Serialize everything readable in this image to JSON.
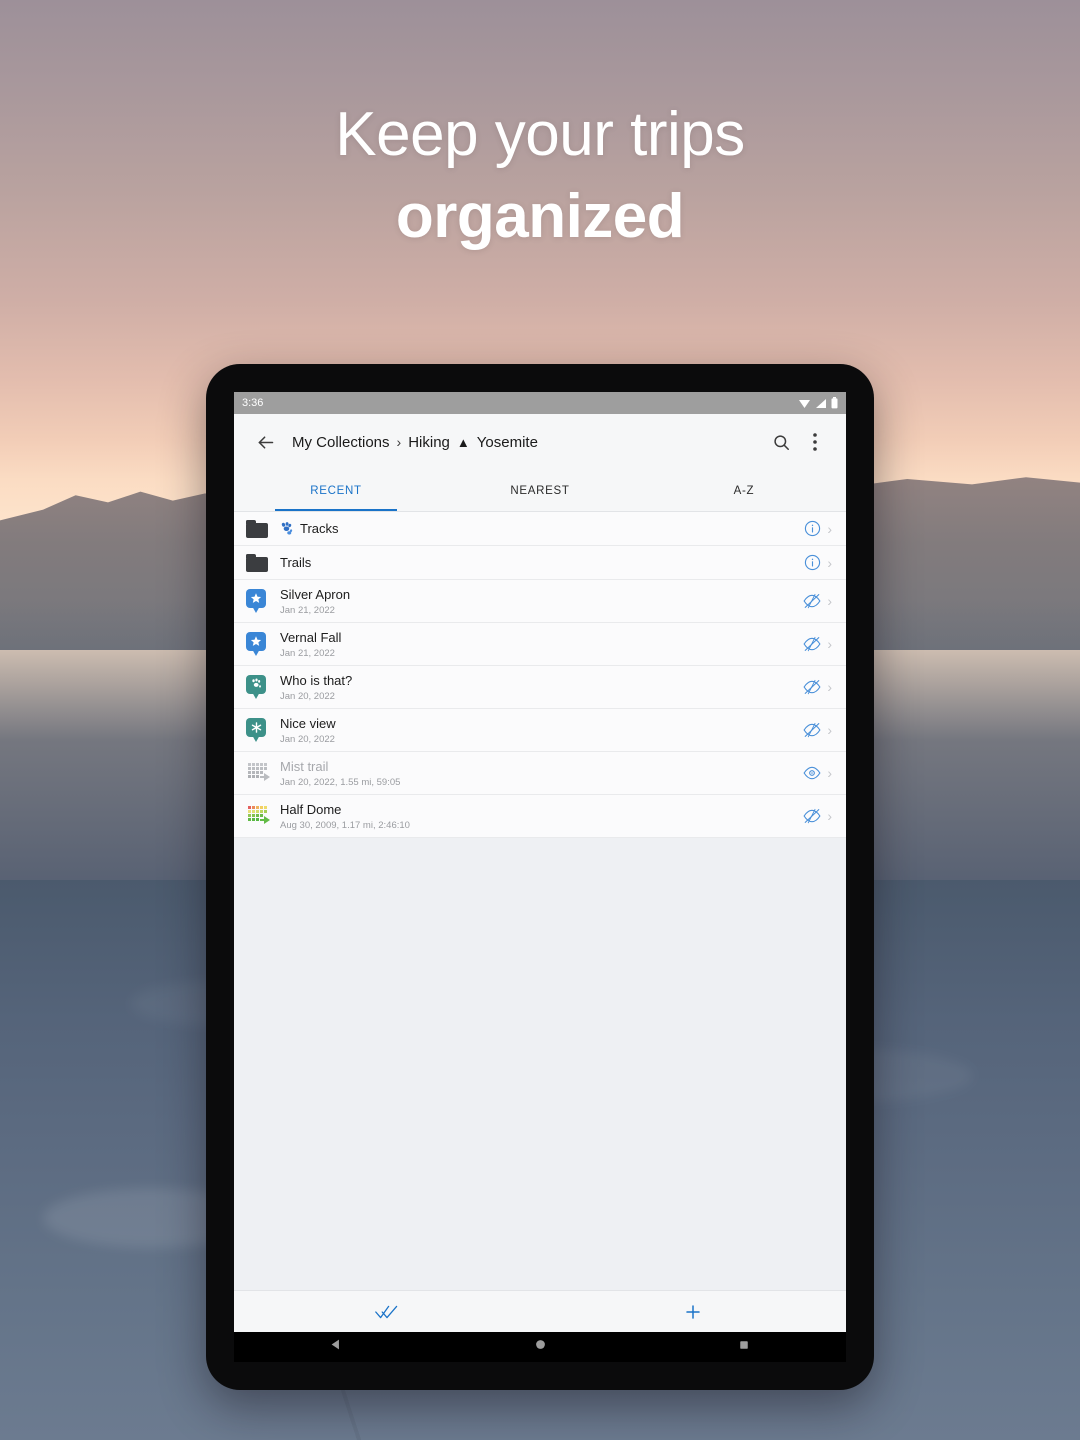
{
  "marketing": {
    "headline_line1": "Keep your trips",
    "headline_line2": "organized"
  },
  "status_bar": {
    "time": "3:36",
    "icons": [
      "wifi-icon",
      "signal-icon",
      "battery-icon"
    ]
  },
  "app_bar": {
    "back_icon": "back-arrow-icon",
    "breadcrumb": {
      "root": "My Collections",
      "separator": "›",
      "parent": "Hiking",
      "marker": "▲",
      "current": "Yosemite"
    },
    "search_icon": "search-icon",
    "overflow_icon": "more-vertical-icon"
  },
  "tabs": [
    {
      "label": "RECENT",
      "active": true
    },
    {
      "label": "NEAREST",
      "active": false
    },
    {
      "label": "A-Z",
      "active": false
    }
  ],
  "list": {
    "folders": [
      {
        "name": "Tracks",
        "badge_icon": "paw-print-icon",
        "has_badge": true,
        "trailing_icon": "info-icon",
        "chevron": "›"
      },
      {
        "name": "Trails",
        "badge_icon": "",
        "has_badge": false,
        "trailing_icon": "info-icon",
        "chevron": "›"
      }
    ],
    "items": [
      {
        "kind": "waypoint",
        "title": "Silver Apron",
        "subtitle": "Jan 21, 2022",
        "icon": "waypoint-star-pin-icon",
        "icon_color": "#3a86d6",
        "glyph": "★",
        "visibility_icon": "eye-hidden-icon",
        "visible": false,
        "chevron": "›",
        "dimmed": false
      },
      {
        "kind": "waypoint",
        "title": "Vernal Fall",
        "subtitle": "Jan 21, 2022",
        "icon": "waypoint-star-pin-icon",
        "icon_color": "#3a86d6",
        "glyph": "★",
        "visibility_icon": "eye-hidden-icon",
        "visible": false,
        "chevron": "›",
        "dimmed": false
      },
      {
        "kind": "waypoint",
        "title": "Who is that?",
        "subtitle": "Jan 20, 2022",
        "icon": "waypoint-paw-pin-icon",
        "icon_color": "#3d9189",
        "glyph": "✿",
        "visibility_icon": "eye-hidden-icon",
        "visible": false,
        "chevron": "›",
        "dimmed": false
      },
      {
        "kind": "waypoint",
        "title": "Nice view",
        "subtitle": "Jan 20, 2022",
        "icon": "waypoint-asterisk-pin-icon",
        "icon_color": "#3d9189",
        "glyph": "✳",
        "visibility_icon": "eye-hidden-icon",
        "visible": false,
        "chevron": "›",
        "dimmed": false
      },
      {
        "kind": "track",
        "title": "Mist trail",
        "subtitle": "Jan 20, 2022, 1.55 mi, 59:05",
        "icon": "track-gray-icon",
        "icon_color": "#b9bbbf",
        "visibility_icon": "eye-visible-icon",
        "visible": true,
        "chevron": "›",
        "dimmed": true
      },
      {
        "kind": "track",
        "title": "Half Dome",
        "subtitle": "Aug 30, 2009, 1.17 mi, 2:46:10",
        "icon": "track-color-icon",
        "icon_color": "#62bb46",
        "visibility_icon": "eye-hidden-icon",
        "visible": false,
        "chevron": "›",
        "dimmed": false
      }
    ]
  },
  "footer": {
    "select_all_icon": "double-check-icon",
    "add_icon": "plus-icon"
  },
  "nav_bar": {
    "back_icon": "nav-back-triangle-icon",
    "home_icon": "nav-home-circle-icon",
    "recents_icon": "nav-recents-square-icon"
  },
  "colors": {
    "accent": "#1a73c8",
    "waypoint_blue": "#3a86d6",
    "waypoint_teal": "#3d9189",
    "status_bar": "#9e9e9e",
    "app_bar": "#f6f7f8",
    "list_bg": "#fbfbfc",
    "page_bg": "#eef0f3"
  }
}
